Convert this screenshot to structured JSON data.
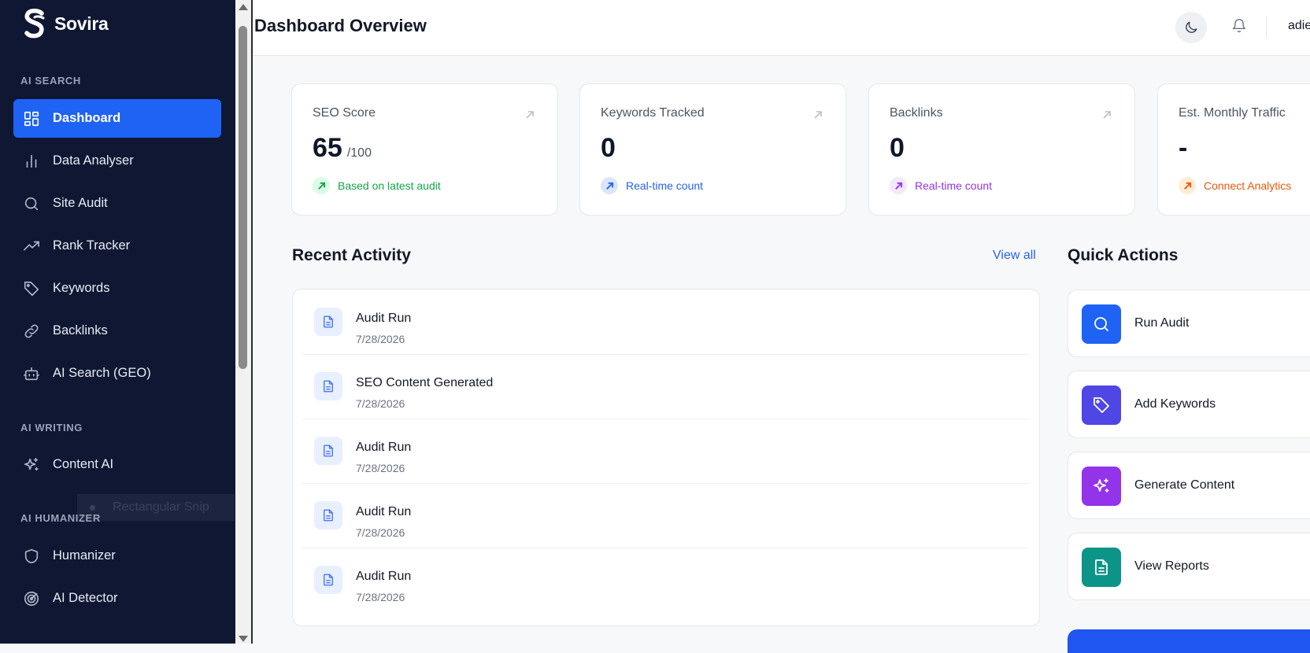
{
  "brand": {
    "name": "Sovira"
  },
  "sidebar": {
    "sections": [
      {
        "label": "AI SEARCH"
      },
      {
        "label": "AI WRITING"
      },
      {
        "label": "AI HUMANIZER"
      }
    ],
    "items": [
      {
        "label": "Dashboard",
        "icon": "grid-icon",
        "active": true
      },
      {
        "label": "Data Analyser",
        "icon": "bar-chart-icon"
      },
      {
        "label": "Site Audit",
        "icon": "search-icon"
      },
      {
        "label": "Rank Tracker",
        "icon": "trending-up-icon"
      },
      {
        "label": "Keywords",
        "icon": "tag-icon"
      },
      {
        "label": "Backlinks",
        "icon": "link-icon"
      },
      {
        "label": "AI Search (GEO)",
        "icon": "bot-icon"
      },
      {
        "label": "Content AI",
        "icon": "sparkles-icon"
      },
      {
        "label": "Humanizer",
        "icon": "shield-icon"
      },
      {
        "label": "AI Detector",
        "icon": "radar-icon"
      }
    ],
    "overlay_text": "Rectangular Snip"
  },
  "header": {
    "title": "Dashboard Overview",
    "user": "adie",
    "theme_icon": "moon-icon",
    "notification_icon": "bell-icon"
  },
  "stats": [
    {
      "label": "SEO Score",
      "value": "65",
      "suffix": "/100",
      "foot": "Based on latest audit",
      "color": "#16a34a",
      "bg": "#dcfce7"
    },
    {
      "label": "Keywords Tracked",
      "value": "0",
      "suffix": "",
      "foot": "Real-time count",
      "color": "#2563eb",
      "bg": "#dbe6fe"
    },
    {
      "label": "Backlinks",
      "value": "0",
      "suffix": "",
      "foot": "Real-time count",
      "color": "#9333ea",
      "bg": "#f3e8ff"
    },
    {
      "label": "Est. Monthly Traffic",
      "value": "-",
      "suffix": "",
      "foot": "Connect Analytics",
      "color": "#ea580c",
      "bg": "#ffedd5"
    }
  ],
  "recent_activity": {
    "title": "Recent Activity",
    "view_all": "View all",
    "items": [
      {
        "title": "Audit Run",
        "date": "7/28/2026"
      },
      {
        "title": "SEO Content Generated",
        "date": "7/28/2026"
      },
      {
        "title": "Audit Run",
        "date": "7/28/2026"
      },
      {
        "title": "Audit Run",
        "date": "7/28/2026"
      },
      {
        "title": "Audit Run",
        "date": "7/28/2026"
      }
    ]
  },
  "quick_actions": {
    "title": "Quick Actions",
    "items": [
      {
        "label": "Run Audit",
        "icon": "search-icon",
        "color": "#1f63f5"
      },
      {
        "label": "Add Keywords",
        "icon": "tag-icon",
        "color": "#4f46e5"
      },
      {
        "label": "Generate Content",
        "icon": "sparkles-icon",
        "color": "#9333ea"
      },
      {
        "label": "View Reports",
        "icon": "file-text-icon",
        "color": "#0d9488"
      }
    ]
  }
}
